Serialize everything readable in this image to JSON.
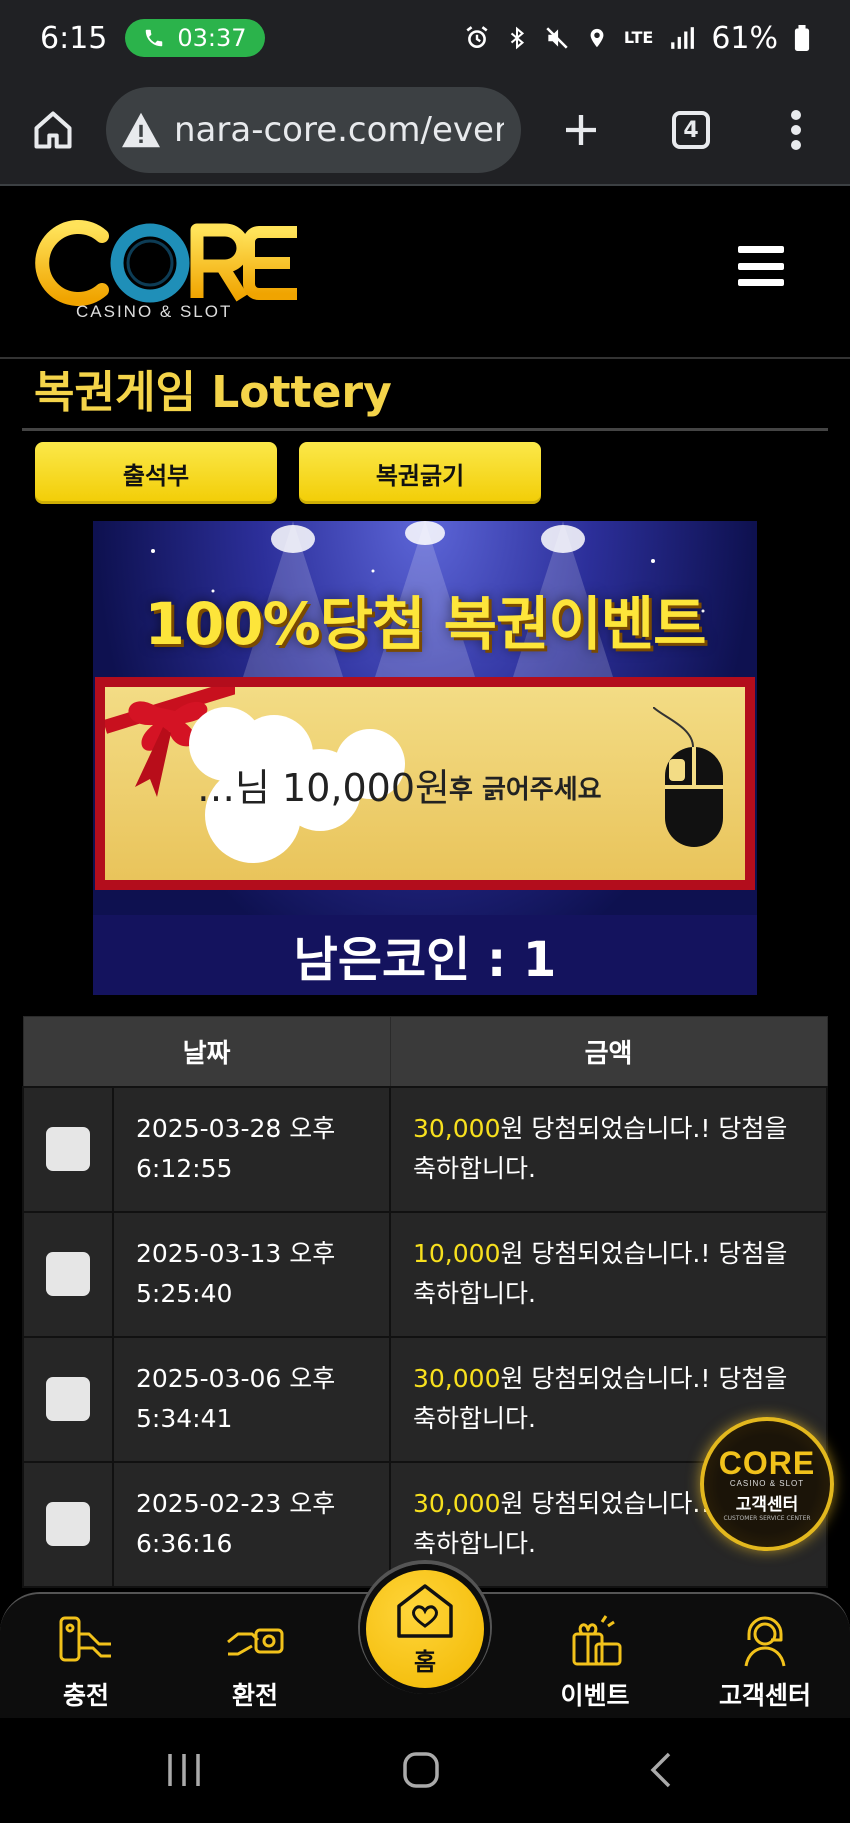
{
  "status_bar": {
    "time": "6:15",
    "call_duration": "03:37",
    "network": "LTE",
    "battery": "61%"
  },
  "browser": {
    "url": "nara-core.com/event",
    "tab_count": "4"
  },
  "site": {
    "logo_text": "CORE",
    "logo_sub": "CASINO & SLOT"
  },
  "page": {
    "title": "복권게임 Lottery",
    "buttons": {
      "attendance": "출석부",
      "scratch": "복권긁기"
    }
  },
  "banner": {
    "headline": "100%당첨 복권이벤트",
    "ticket_hint": "후 긁어주세요",
    "prize": "…님  10,000원",
    "remaining_coins": "남은코인 : 1"
  },
  "table": {
    "headers": [
      "날짜",
      "금액"
    ],
    "rows": [
      {
        "date": "2025-03-28 오후 6:12:55",
        "amount": "30,000",
        "message": "원 당첨되었습니다.! 당첨을 축하합니다."
      },
      {
        "date": "2025-03-13 오후 5:25:40",
        "amount": "10,000",
        "message": "원 당첨되었습니다.! 당첨을 축하합니다."
      },
      {
        "date": "2025-03-06 오후 5:34:41",
        "amount": "30,000",
        "message": "원 당첨되었습니다.! 당첨을 축하합니다."
      },
      {
        "date": "2025-02-23 오후 6:36:16",
        "amount": "30,000",
        "message": "원 당첨되었습니다.! 당첨을 축하합니다."
      }
    ]
  },
  "cs_badge": {
    "logo": "CORE",
    "sub": "CASINO & SLOT",
    "label": "고객센터",
    "en": "CUSTOMER SERVICE CENTER"
  },
  "bottom_nav": {
    "deposit": "충전",
    "withdraw": "환전",
    "home": "홈",
    "event": "이벤트",
    "support": "고객센터"
  },
  "colors": {
    "accent_yellow": "#f4d44a",
    "amount_yellow": "#f7e01e",
    "call_green": "#2bb34b",
    "ticket_red": "#b30d1c"
  }
}
